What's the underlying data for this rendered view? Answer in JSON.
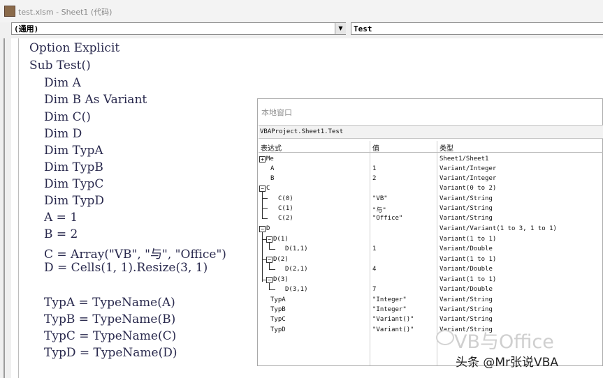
{
  "window": {
    "title": "test.xlsm - Sheet1 (代码)"
  },
  "toolbar": {
    "object_combo": "(通用)",
    "proc_combo": "Test",
    "dropdown_glyph": "▼"
  },
  "code": {
    "lines": [
      "Option Explicit",
      "Sub Test()",
      "Dim A",
      "Dim B As Variant",
      "Dim C()",
      "Dim D",
      "Dim TypA",
      "Dim TypB",
      "Dim TypC",
      "Dim TypD",
      "A = 1",
      "B = 2",
      "C = Array(\"VB\", \"与\", \"Office\")",
      "D = Cells(1, 1).Resize(3, 1)",
      "TypA = TypeName(A)",
      "TypB = TypeName(B)",
      "TypC = TypeName(C)",
      "TypD = TypeName(D)"
    ]
  },
  "locals": {
    "title": "本地窗口",
    "context": "VBAProject.Sheet1.Test",
    "headers": {
      "expr": "表达式",
      "value": "值",
      "type": "类型"
    },
    "rows": [
      {
        "expr": "Me",
        "value": "",
        "type": "Sheet1/Sheet1"
      },
      {
        "expr": "A",
        "value": "1",
        "type": "Variant/Integer"
      },
      {
        "expr": "B",
        "value": "2",
        "type": "Variant/Integer"
      },
      {
        "expr": "C",
        "value": "",
        "type": "Variant(0 to 2)"
      },
      {
        "expr": "C(0)",
        "value": "\"VB\"",
        "type": "Variant/String"
      },
      {
        "expr": "C(1)",
        "value": "\"与\"",
        "type": "Variant/String"
      },
      {
        "expr": "C(2)",
        "value": "\"Office\"",
        "type": "Variant/String"
      },
      {
        "expr": "D",
        "value": "",
        "type": "Variant/Variant(1 to 3, 1 to 1)"
      },
      {
        "expr": "D(1)",
        "value": "",
        "type": "Variant(1 to 1)"
      },
      {
        "expr": "D(1,1)",
        "value": "1",
        "type": "Variant/Double"
      },
      {
        "expr": "D(2)",
        "value": "",
        "type": "Variant(1 to 1)"
      },
      {
        "expr": "D(2,1)",
        "value": "4",
        "type": "Variant/Double"
      },
      {
        "expr": "D(3)",
        "value": "",
        "type": "Variant(1 to 1)"
      },
      {
        "expr": "D(3,1)",
        "value": "7",
        "type": "Variant/Double"
      },
      {
        "expr": "TypA",
        "value": "\"Integer\"",
        "type": "Variant/String"
      },
      {
        "expr": "TypB",
        "value": "\"Integer\"",
        "type": "Variant/String"
      },
      {
        "expr": "TypC",
        "value": "\"Variant()\"",
        "type": "Variant/String"
      },
      {
        "expr": "TypD",
        "value": "\"Variant()\"",
        "type": "Variant/String"
      }
    ]
  },
  "watermark": {
    "text": "VB与Office"
  },
  "credit": {
    "text": "头条 @Mr张说VBA"
  }
}
